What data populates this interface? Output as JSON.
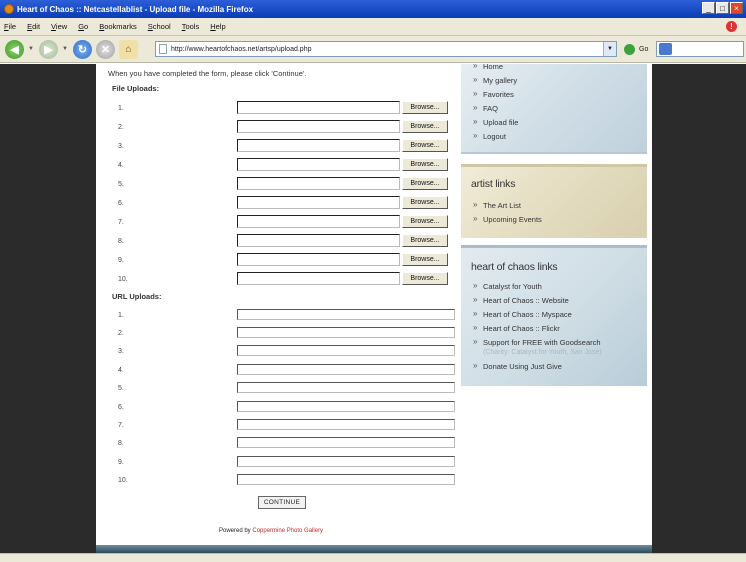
{
  "window": {
    "title": "Heart of Chaos :: Netcastellablist - Upload file - Mozilla Firefox",
    "minimize": "_",
    "maximize": "□",
    "close": "×"
  },
  "menu": [
    "File",
    "Edit",
    "View",
    "Go",
    "Bookmarks",
    "School",
    "Tools",
    "Help"
  ],
  "toolbar": {
    "url": "http://www.heartofchaos.net/artsp/upload.php",
    "go_label": "Go"
  },
  "form": {
    "intro": "When you have completed the form, please click 'Continue'.",
    "file_heading": "File Uploads:",
    "file_rows": [
      "1.",
      "2.",
      "3.",
      "4.",
      "5.",
      "6.",
      "7.",
      "8.",
      "9.",
      "10."
    ],
    "browse_label": "Browse...",
    "url_heading": "URL Uploads:",
    "url_rows": [
      "1.",
      "2.",
      "3.",
      "4.",
      "5.",
      "6.",
      "7.",
      "8.",
      "9.",
      "10."
    ],
    "continue_label": "CONTINUE",
    "powered_prefix": "Powered by ",
    "powered_link": "Coppermine Photo Gallery"
  },
  "sidebar": {
    "top_links": [
      "Home",
      "My gallery",
      "Favorites",
      "FAQ",
      "Upload file",
      "Logout"
    ],
    "artist_title": "artist links",
    "artist_links": [
      "The Art List",
      "Upcoming Events"
    ],
    "hoc_title": "heart of chaos links",
    "hoc_links": [
      "Catalyst for Youth",
      "Heart of Chaos :: Website",
      "Heart of Chaos :: Myspace",
      "Heart of Chaos :: Flickr",
      "Support for FREE with Goodsearch"
    ],
    "goodsearch_sub": "(Charity: Catalyst for Youth, San Jose)",
    "donate_link": "Donate Using Just Give"
  },
  "colors": {
    "page_bg": "#2b2b2b",
    "link_red": "#c0302a"
  }
}
